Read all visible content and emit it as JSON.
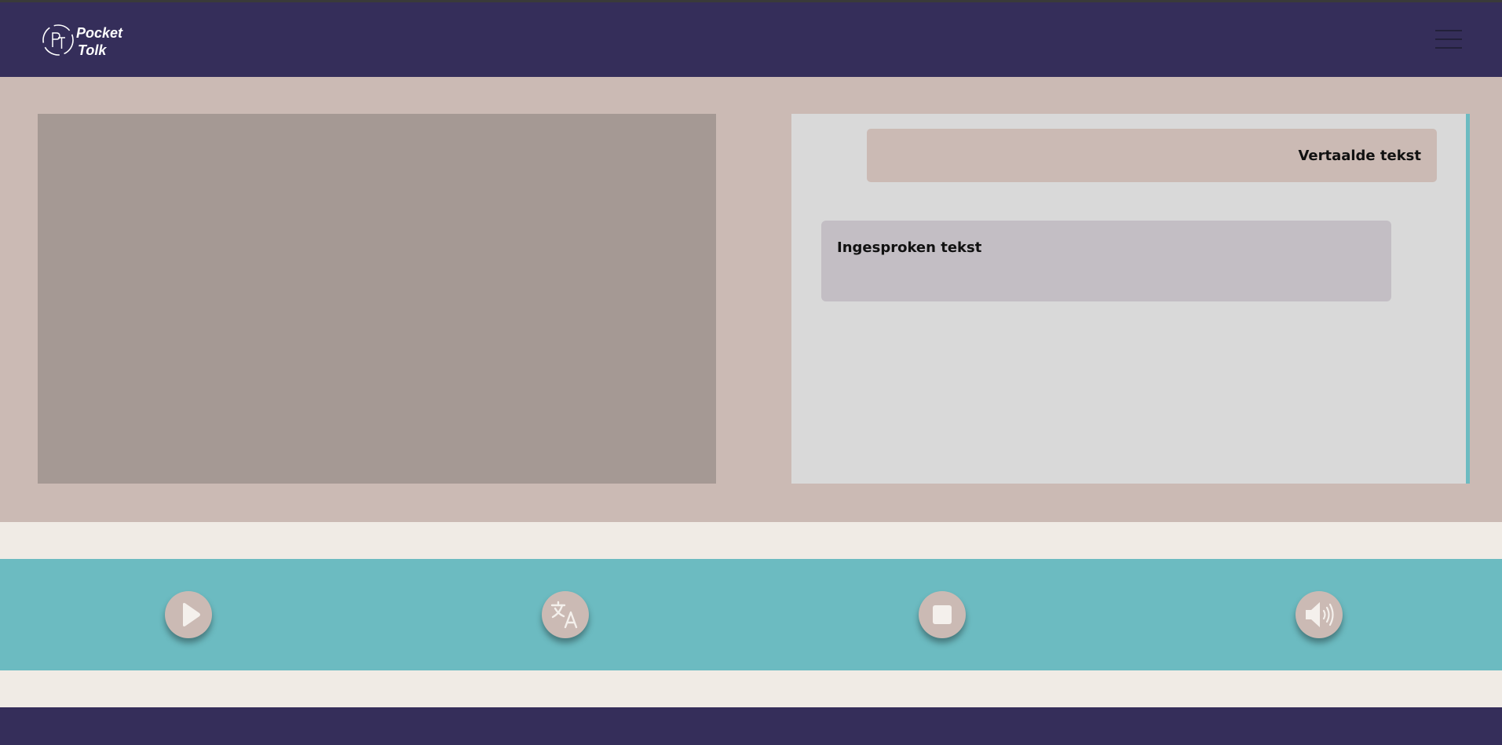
{
  "brand": {
    "logo_initials": "PT",
    "name_line1": "Pocket",
    "name_line2": "Tolk"
  },
  "header": {
    "menu_icon": "hamburger-menu-icon"
  },
  "conversation": {
    "translated_text": "Vertaalde tekst",
    "spoken_text": "Ingesproken tekst"
  },
  "controls": [
    {
      "icon": "play-icon"
    },
    {
      "icon": "translate-icon"
    },
    {
      "icon": "stop-icon"
    },
    {
      "icon": "speaker-volume-icon"
    }
  ],
  "colors": {
    "header": "#352e5a",
    "main_bg": "#cbbab4",
    "video_panel": "#a59994",
    "text_panel": "#d9d9d9",
    "controls_bar": "#6cbbc1",
    "page_bg": "#f0ebe5"
  }
}
